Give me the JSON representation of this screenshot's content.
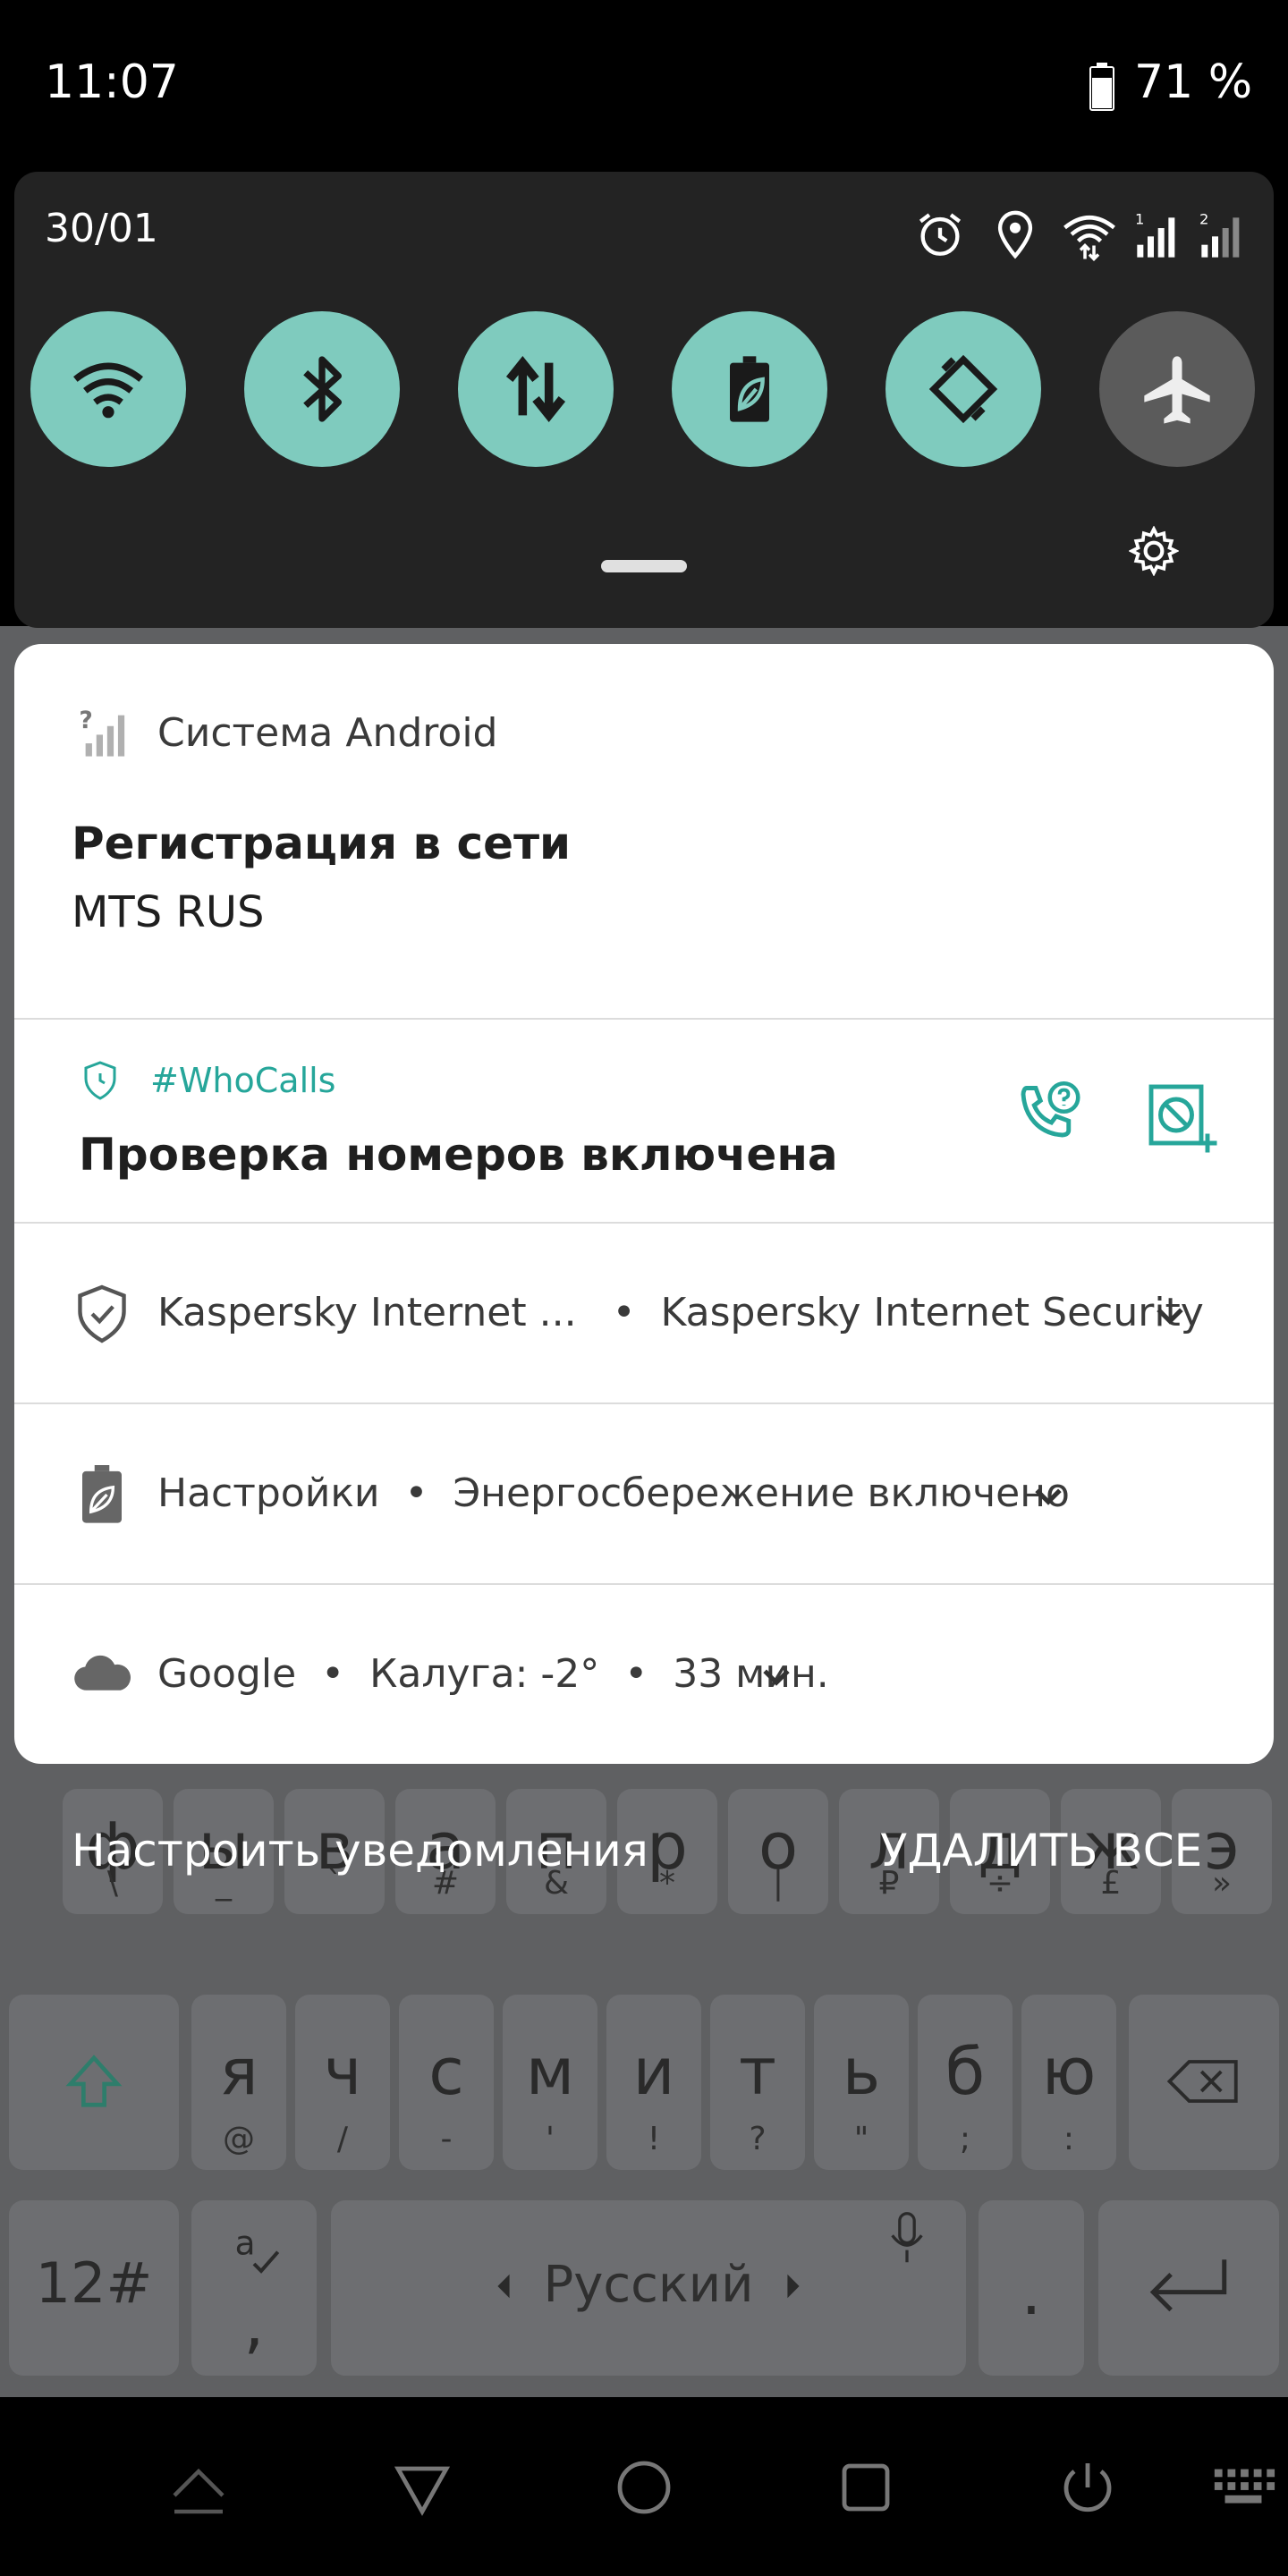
{
  "status_bar": {
    "time": "11:07",
    "battery": "71 %",
    "battery_icon": "battery-icon"
  },
  "quick_settings": {
    "date": "30/01",
    "status_icons": [
      "alarm-icon",
      "location-icon",
      "wifi-signal-icon",
      "sim1-signal-icon",
      "sim2-signal-icon"
    ],
    "tiles": [
      {
        "name": "wifi",
        "icon": "wifi-icon",
        "active": true
      },
      {
        "name": "bluetooth",
        "icon": "bluetooth-icon",
        "active": true
      },
      {
        "name": "mobile-data",
        "icon": "data-arrows-icon",
        "active": true
      },
      {
        "name": "battery-saver",
        "icon": "battery-saver-icon",
        "active": true
      },
      {
        "name": "auto-rotate",
        "icon": "rotate-icon",
        "active": true
      },
      {
        "name": "airplane",
        "icon": "airplane-icon",
        "active": false
      }
    ],
    "settings_icon": "gear-icon"
  },
  "notifications": {
    "android": {
      "app": "Система Android",
      "title": "Регистрация в сети",
      "text": "MTS RUS"
    },
    "whocalls": {
      "app": "#WhoCalls",
      "title": "Проверка номеров включена"
    },
    "kaspersky": {
      "app": "Kaspersky Internet ...",
      "sep": "•",
      "text": "Kaspersky Internet Security"
    },
    "settings": {
      "app": "Настройки",
      "sep": "•",
      "text": "Энергосбережение включено"
    },
    "google": {
      "app": "Google",
      "sep1": "•",
      "weather": "Калуга: -2°",
      "sep2": "•",
      "time": "33 мин."
    }
  },
  "actions": {
    "manage": "Настроить уведомления",
    "clear_all": "УДАЛИТЬ ВСЕ"
  },
  "keyboard": {
    "row1": [
      {
        "main": "ф",
        "sub": "\\"
      },
      {
        "main": "ы",
        "sub": "_"
      },
      {
        "main": "в",
        "sub": "`"
      },
      {
        "main": "а",
        "sub": "#"
      },
      {
        "main": "п",
        "sub": "&"
      },
      {
        "main": "р",
        "sub": "*"
      },
      {
        "main": "о",
        "sub": "|"
      },
      {
        "main": "л",
        "sub": "₽"
      },
      {
        "main": "д",
        "sub": "÷"
      },
      {
        "main": "ж",
        "sub": "£"
      },
      {
        "main": "э",
        "sub": "»"
      }
    ],
    "row2": [
      {
        "main": "я",
        "sub": "@"
      },
      {
        "main": "ч",
        "sub": "/"
      },
      {
        "main": "с",
        "sub": "-"
      },
      {
        "main": "м",
        "sub": "'"
      },
      {
        "main": "и",
        "sub": "!"
      },
      {
        "main": "т",
        "sub": "?"
      },
      {
        "main": "ь",
        "sub": "\""
      },
      {
        "main": "б",
        "sub": ";"
      },
      {
        "main": "ю",
        "sub": ":"
      }
    ],
    "symbols": "12#",
    "comma_key": ",",
    "space": "Русский",
    "period": "."
  },
  "colors": {
    "accent": "#26a69a",
    "tile_active": "#7fcbbe",
    "tile_inactive": "#5b5b5b"
  }
}
